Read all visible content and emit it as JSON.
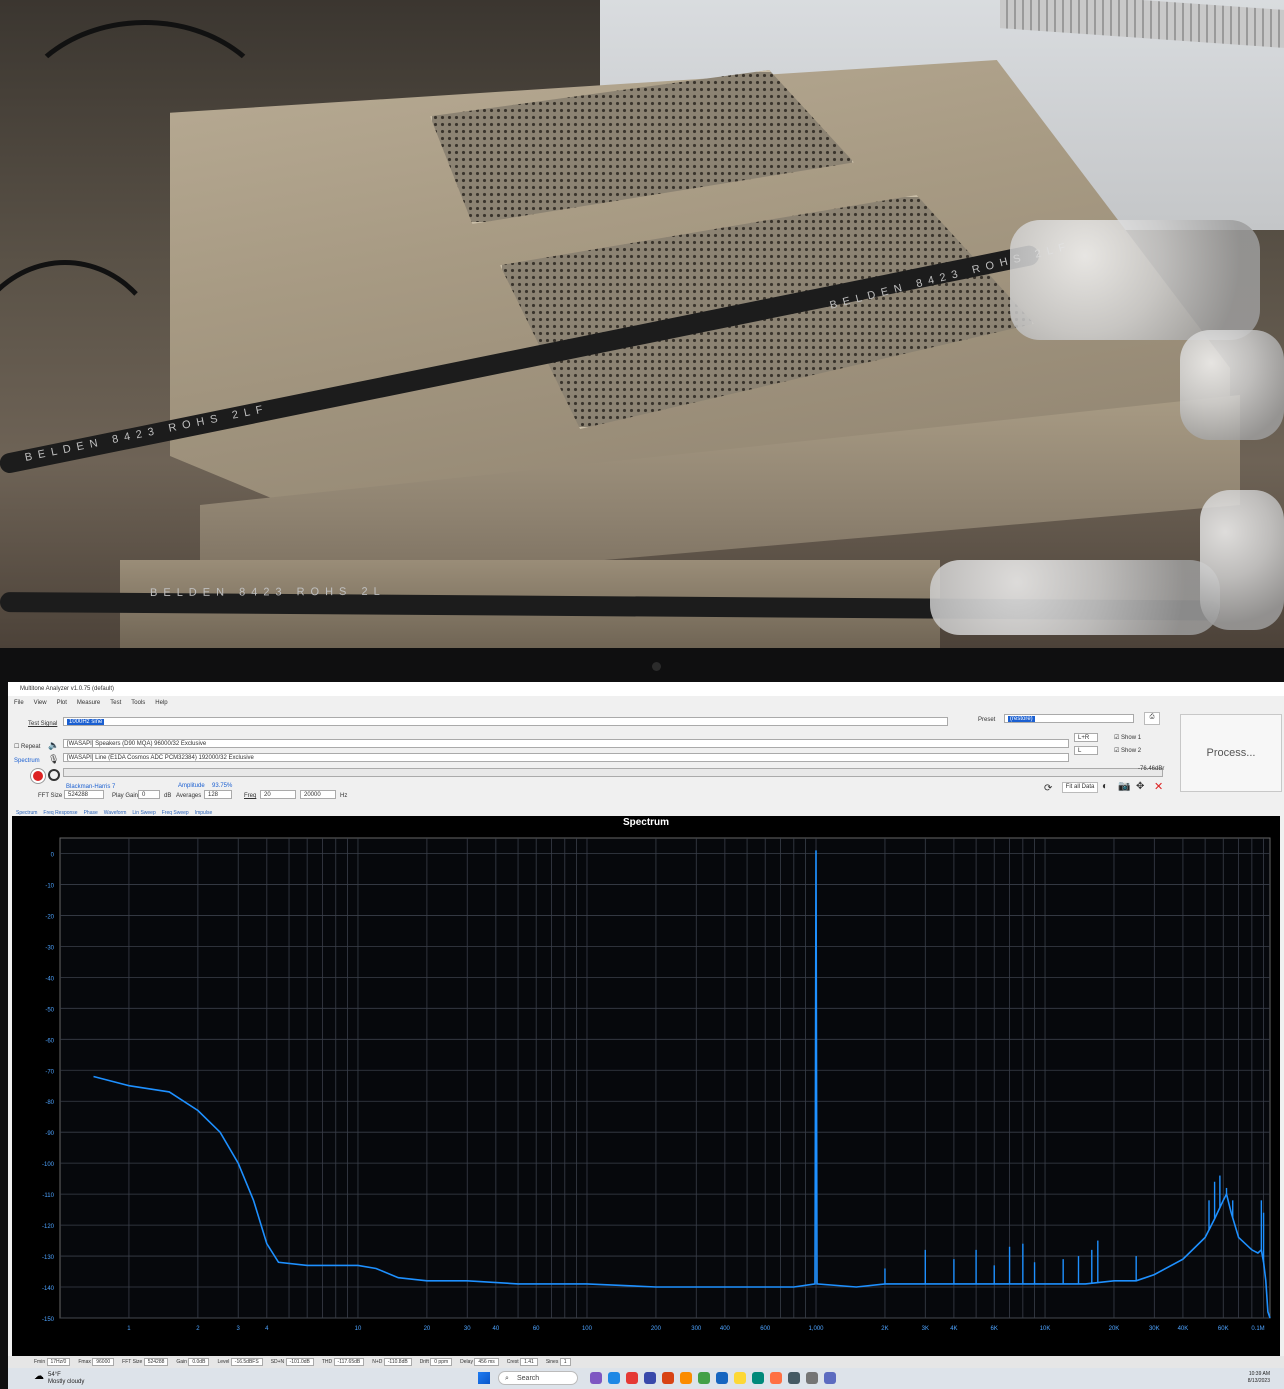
{
  "photo": {
    "cable_text_top": "BELDEN 8423 ROHS 2LF",
    "cable_text_mid": "BELDEN 8423 ROHS 2LF",
    "cable_text_bottom": "BELDEN 8423 ROHS 2L"
  },
  "app": {
    "title": "Multitone Analyzer v1.0.75 (default)",
    "menu": [
      "File",
      "View",
      "Plot",
      "Measure",
      "Test",
      "Tools",
      "Help"
    ],
    "test_signal_label": "Test Signal",
    "test_signal_value": "1000Hz sine",
    "preset_label": "Preset",
    "preset_value": "(restore)",
    "repeat_label": "Repeat",
    "output_device": "[WASAPI] Speakers (D90 MQA) 96000/32 Exclusive",
    "input_device": "[WASAPI] Line (E1DA Cosmos ADC PCM32384) 192000/32 Exclusive",
    "spectrum_label": "Spectrum",
    "channel_out": "L+R",
    "channel_in": "L",
    "show1_label": "Show 1",
    "show2_label": "Show 2",
    "level_readout": "-76.46dBr",
    "window_label": "Blackman-Harris 7",
    "fft_size_label": "FFT Size",
    "fft_size_value": "524288",
    "play_gain_label": "Play Gain",
    "play_gain_value": "0",
    "play_gain_unit": "dB",
    "amplitude_label": "Amplitude",
    "amplitude_value": "93.75%",
    "averages_label": "Averages",
    "averages_value": "128",
    "freq_label": "Freq",
    "freq_from": "20",
    "freq_to": "20000",
    "freq_unit": "Hz",
    "fit_label": "Fit all Data",
    "process_label": "Process...",
    "tabs": [
      "Spectrum",
      "Freq Response",
      "Phase",
      "Waveform",
      "Lin Sweep",
      "Freq Sweep",
      "Impulse"
    ],
    "status": [
      {
        "k": "Fmin",
        "v": "17Hz/0"
      },
      {
        "k": "Fmax",
        "v": "96000"
      },
      {
        "k": "FFT Size",
        "v": "524288"
      },
      {
        "k": "Gain",
        "v": "0.0dB"
      },
      {
        "k": "Level",
        "v": "-16.5dBFS"
      },
      {
        "k": "SD+N",
        "v": "-101.0dB"
      },
      {
        "k": "THD",
        "v": "-117.65dB"
      },
      {
        "k": "N+D",
        "v": "-110.8dB"
      },
      {
        "k": "Drift",
        "v": "0 ppm"
      },
      {
        "k": "Delay",
        "v": "456 ms"
      },
      {
        "k": "Crest",
        "v": "1.41"
      },
      {
        "k": "Sines",
        "v": "1"
      }
    ]
  },
  "taskbar": {
    "weather_temp": "54°F",
    "weather_desc": "Mostly cloudy",
    "search_label": "Search",
    "time": "10:39 AM",
    "date": "8/13/2023"
  },
  "chart_data": {
    "type": "line",
    "title": "Spectrum",
    "xscale": "log",
    "xlim": [
      0.5,
      96000
    ],
    "ylim": [
      -150,
      5
    ],
    "grid": true,
    "xticks": [
      1,
      2,
      3,
      4,
      10,
      20,
      30,
      40,
      60,
      100,
      200,
      300,
      400,
      600,
      1000,
      2000,
      3000,
      4000,
      6000,
      10000,
      20000,
      30000,
      40000,
      60000,
      100000
    ],
    "xtick_labels": [
      "1",
      "2",
      "3",
      "4",
      "10",
      "20",
      "30",
      "40",
      "60",
      "100",
      "200",
      "300",
      "400",
      "600",
      "1,000",
      "2K",
      "3K",
      "4K",
      "6K",
      "10K",
      "20K",
      "30K",
      "40K",
      "60K",
      "0.1M"
    ],
    "yticks": [
      0,
      -10,
      -20,
      -30,
      -40,
      -50,
      -60,
      -70,
      -80,
      -90,
      -100,
      -110,
      -120,
      -130,
      -140,
      -150
    ],
    "ytick_labels": [
      "0",
      "-10",
      "-20",
      "-30",
      "-40",
      "-50",
      "-60",
      "-70",
      "-80",
      "-90",
      "-100",
      "-110",
      "-120",
      "-130",
      "-140",
      "-150"
    ],
    "series": [
      {
        "color": "#1e90ff",
        "x": [
          0.7,
          1,
          1.5,
          2,
          2.5,
          3,
          3.5,
          4,
          4.5,
          6,
          8,
          10,
          12,
          15,
          20,
          30,
          50,
          100,
          200,
          300,
          500,
          800,
          990,
          1000,
          1010,
          1500,
          2000,
          3000,
          5000,
          8000,
          10000,
          15000,
          20000,
          25000,
          30000,
          40000,
          50000,
          55000,
          60000,
          62000,
          65000,
          70000,
          80000,
          85000,
          88000,
          90000,
          92000,
          94000,
          96000
        ],
        "y": [
          -72,
          -75,
          -77,
          -83,
          -90,
          -100,
          -112,
          -126,
          -132,
          -133,
          -133,
          -133,
          -134,
          -137,
          -138,
          -138,
          -139,
          -139,
          -140,
          -140,
          -140,
          -140,
          -139,
          1,
          -139,
          -140,
          -139,
          -139,
          -139,
          -139,
          -139,
          -139,
          -138,
          -138,
          -136,
          -131,
          -124,
          -118,
          -112,
          -110,
          -116,
          -124,
          -128,
          -129,
          -128,
          -132,
          -138,
          -148,
          -150
        ]
      }
    ],
    "spurs": [
      {
        "x": 2000,
        "y": -134
      },
      {
        "x": 3000,
        "y": -128
      },
      {
        "x": 4000,
        "y": -131
      },
      {
        "x": 5000,
        "y": -128
      },
      {
        "x": 6000,
        "y": -133
      },
      {
        "x": 7000,
        "y": -127
      },
      {
        "x": 8000,
        "y": -126
      },
      {
        "x": 9000,
        "y": -132
      },
      {
        "x": 12000,
        "y": -131
      },
      {
        "x": 14000,
        "y": -130
      },
      {
        "x": 16000,
        "y": -128
      },
      {
        "x": 17000,
        "y": -125
      },
      {
        "x": 25000,
        "y": -130
      },
      {
        "x": 52000,
        "y": -112
      },
      {
        "x": 55000,
        "y": -106
      },
      {
        "x": 58000,
        "y": -104
      },
      {
        "x": 62000,
        "y": -108
      },
      {
        "x": 66000,
        "y": -112
      },
      {
        "x": 88000,
        "y": -112
      },
      {
        "x": 90000,
        "y": -116
      }
    ]
  }
}
